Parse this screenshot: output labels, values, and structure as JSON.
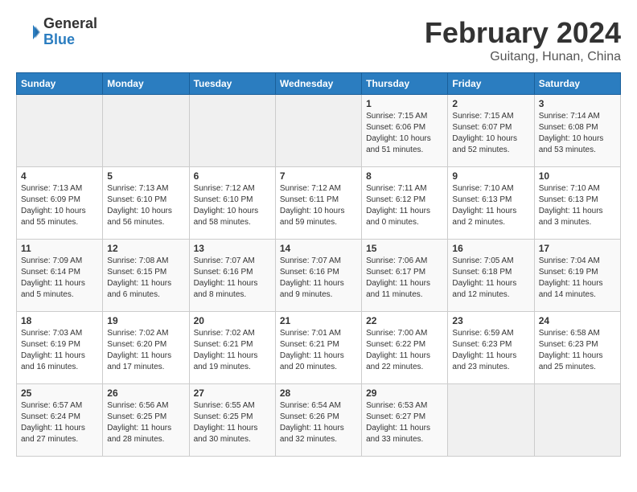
{
  "header": {
    "logo_general": "General",
    "logo_blue": "Blue",
    "title": "February 2024",
    "subtitle": "Guitang, Hunan, China"
  },
  "weekdays": [
    "Sunday",
    "Monday",
    "Tuesday",
    "Wednesday",
    "Thursday",
    "Friday",
    "Saturday"
  ],
  "weeks": [
    [
      {
        "day": "",
        "info": ""
      },
      {
        "day": "",
        "info": ""
      },
      {
        "day": "",
        "info": ""
      },
      {
        "day": "",
        "info": ""
      },
      {
        "day": "1",
        "info": "Sunrise: 7:15 AM\nSunset: 6:06 PM\nDaylight: 10 hours\nand 51 minutes."
      },
      {
        "day": "2",
        "info": "Sunrise: 7:15 AM\nSunset: 6:07 PM\nDaylight: 10 hours\nand 52 minutes."
      },
      {
        "day": "3",
        "info": "Sunrise: 7:14 AM\nSunset: 6:08 PM\nDaylight: 10 hours\nand 53 minutes."
      }
    ],
    [
      {
        "day": "4",
        "info": "Sunrise: 7:13 AM\nSunset: 6:09 PM\nDaylight: 10 hours\nand 55 minutes."
      },
      {
        "day": "5",
        "info": "Sunrise: 7:13 AM\nSunset: 6:10 PM\nDaylight: 10 hours\nand 56 minutes."
      },
      {
        "day": "6",
        "info": "Sunrise: 7:12 AM\nSunset: 6:10 PM\nDaylight: 10 hours\nand 58 minutes."
      },
      {
        "day": "7",
        "info": "Sunrise: 7:12 AM\nSunset: 6:11 PM\nDaylight: 10 hours\nand 59 minutes."
      },
      {
        "day": "8",
        "info": "Sunrise: 7:11 AM\nSunset: 6:12 PM\nDaylight: 11 hours\nand 0 minutes."
      },
      {
        "day": "9",
        "info": "Sunrise: 7:10 AM\nSunset: 6:13 PM\nDaylight: 11 hours\nand 2 minutes."
      },
      {
        "day": "10",
        "info": "Sunrise: 7:10 AM\nSunset: 6:13 PM\nDaylight: 11 hours\nand 3 minutes."
      }
    ],
    [
      {
        "day": "11",
        "info": "Sunrise: 7:09 AM\nSunset: 6:14 PM\nDaylight: 11 hours\nand 5 minutes."
      },
      {
        "day": "12",
        "info": "Sunrise: 7:08 AM\nSunset: 6:15 PM\nDaylight: 11 hours\nand 6 minutes."
      },
      {
        "day": "13",
        "info": "Sunrise: 7:07 AM\nSunset: 6:16 PM\nDaylight: 11 hours\nand 8 minutes."
      },
      {
        "day": "14",
        "info": "Sunrise: 7:07 AM\nSunset: 6:16 PM\nDaylight: 11 hours\nand 9 minutes."
      },
      {
        "day": "15",
        "info": "Sunrise: 7:06 AM\nSunset: 6:17 PM\nDaylight: 11 hours\nand 11 minutes."
      },
      {
        "day": "16",
        "info": "Sunrise: 7:05 AM\nSunset: 6:18 PM\nDaylight: 11 hours\nand 12 minutes."
      },
      {
        "day": "17",
        "info": "Sunrise: 7:04 AM\nSunset: 6:19 PM\nDaylight: 11 hours\nand 14 minutes."
      }
    ],
    [
      {
        "day": "18",
        "info": "Sunrise: 7:03 AM\nSunset: 6:19 PM\nDaylight: 11 hours\nand 16 minutes."
      },
      {
        "day": "19",
        "info": "Sunrise: 7:02 AM\nSunset: 6:20 PM\nDaylight: 11 hours\nand 17 minutes."
      },
      {
        "day": "20",
        "info": "Sunrise: 7:02 AM\nSunset: 6:21 PM\nDaylight: 11 hours\nand 19 minutes."
      },
      {
        "day": "21",
        "info": "Sunrise: 7:01 AM\nSunset: 6:21 PM\nDaylight: 11 hours\nand 20 minutes."
      },
      {
        "day": "22",
        "info": "Sunrise: 7:00 AM\nSunset: 6:22 PM\nDaylight: 11 hours\nand 22 minutes."
      },
      {
        "day": "23",
        "info": "Sunrise: 6:59 AM\nSunset: 6:23 PM\nDaylight: 11 hours\nand 23 minutes."
      },
      {
        "day": "24",
        "info": "Sunrise: 6:58 AM\nSunset: 6:23 PM\nDaylight: 11 hours\nand 25 minutes."
      }
    ],
    [
      {
        "day": "25",
        "info": "Sunrise: 6:57 AM\nSunset: 6:24 PM\nDaylight: 11 hours\nand 27 minutes."
      },
      {
        "day": "26",
        "info": "Sunrise: 6:56 AM\nSunset: 6:25 PM\nDaylight: 11 hours\nand 28 minutes."
      },
      {
        "day": "27",
        "info": "Sunrise: 6:55 AM\nSunset: 6:25 PM\nDaylight: 11 hours\nand 30 minutes."
      },
      {
        "day": "28",
        "info": "Sunrise: 6:54 AM\nSunset: 6:26 PM\nDaylight: 11 hours\nand 32 minutes."
      },
      {
        "day": "29",
        "info": "Sunrise: 6:53 AM\nSunset: 6:27 PM\nDaylight: 11 hours\nand 33 minutes."
      },
      {
        "day": "",
        "info": ""
      },
      {
        "day": "",
        "info": ""
      }
    ]
  ]
}
